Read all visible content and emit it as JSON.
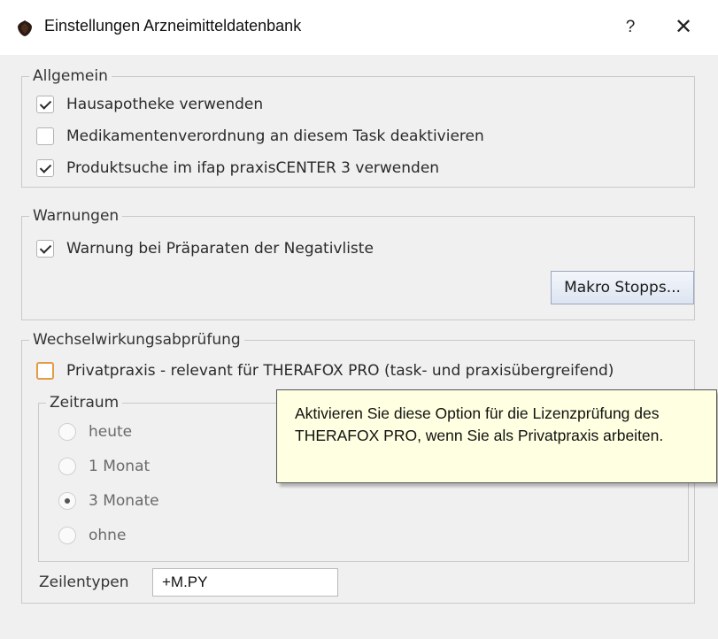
{
  "window": {
    "title": "Einstellungen Arzneimitteldatenbank",
    "help_label": "?",
    "close_label": "✕"
  },
  "allgemein": {
    "legend": "Allgemein",
    "options": [
      {
        "label": "Hausapotheke verwenden",
        "checked": true
      },
      {
        "label": "Medikamentenverordnung an diesem Task deaktivieren",
        "checked": false
      },
      {
        "label": "Produktsuche im ifap praxisCENTER 3 verwenden",
        "checked": true
      }
    ]
  },
  "warnungen": {
    "legend": "Warnungen",
    "option": {
      "label": "Warnung bei Präparaten der Negativliste",
      "checked": true
    },
    "button_label": "Makro Stopps..."
  },
  "wechselwirkung": {
    "legend": "Wechselwirkungsabprüfung",
    "privatpraxis": {
      "label": "Privatpraxis - relevant für THERAFOX PRO (task- und praxisübergreifend)",
      "checked": false
    },
    "zeitraum": {
      "legend": "Zeitraum",
      "options": [
        {
          "label": "heute",
          "selected": false
        },
        {
          "label": "1 Monat",
          "selected": false
        },
        {
          "label": "3 Monate",
          "selected": true
        },
        {
          "label": "ohne",
          "selected": false
        }
      ]
    },
    "zeilentypen": {
      "label": "Zeilentypen",
      "value": "+M.PY"
    }
  },
  "tooltip": {
    "text": "Aktivieren Sie diese Option für die Lizenzprüfung des THERAFOX PRO, wenn Sie als Privatpraxis arbeiten."
  },
  "colors": {
    "tooltip_bg": "#ffffe1",
    "focus_border": "#e59a45",
    "button_border": "#9aa7bf"
  }
}
